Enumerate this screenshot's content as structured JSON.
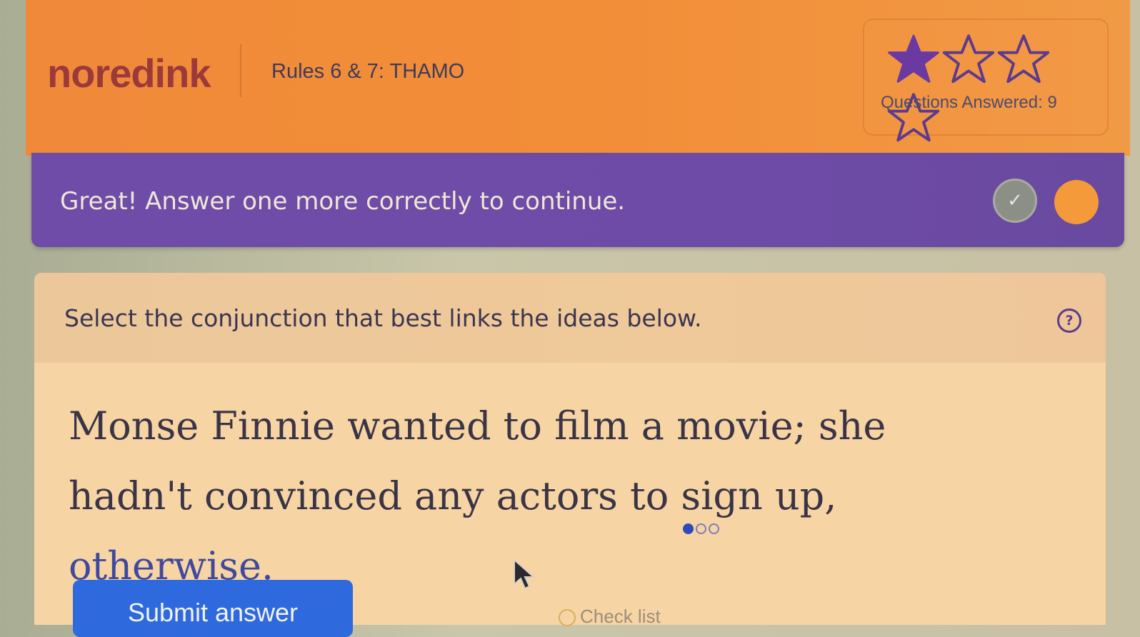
{
  "header": {
    "logo": "noredink",
    "lesson_title": "Rules 6 & 7: THAMO",
    "stars": {
      "filled": 1,
      "total": 4
    },
    "questions_answered": "Questions Answered: 9"
  },
  "banner": {
    "message": "Great! Answer one more correctly to continue.",
    "check_glyph": "✓"
  },
  "question": {
    "instruction": "Select the conjunction that best links the ideas below.",
    "help_glyph": "?",
    "sentence_before": "Monse Finnie wanted to film a movie; she hadn't convinced any actors to sign up, ",
    "choice": "otherwise.",
    "cycle": {
      "current": 1,
      "total": 3
    }
  },
  "actions": {
    "submit_label": "Submit answer",
    "cut_text": "Check list"
  },
  "colors": {
    "header_orange": "#f28d38",
    "banner_purple": "#6e4ca8",
    "submit_blue": "#2f69de",
    "star_filled": "#6a3aa2"
  },
  "icons": [
    "star-filled-icon",
    "star-empty-icon",
    "check-icon",
    "help-icon",
    "cursor-arrow-icon"
  ]
}
